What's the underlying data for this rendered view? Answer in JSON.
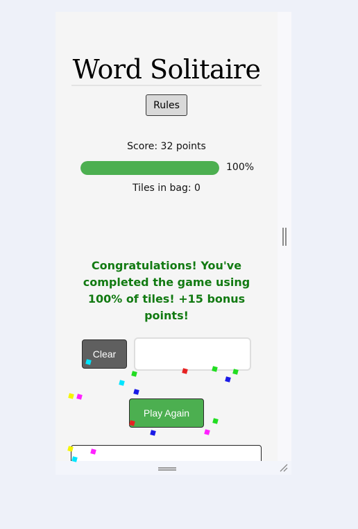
{
  "title": "Word Solitaire",
  "rules_button": "Rules",
  "score_text": "Score: 32 points",
  "progress": {
    "percent": 100,
    "label": "100%"
  },
  "tiles_text": "Tiles in bag: 0",
  "congrats_text": "Congratulations! You've completed the game using 100% of tiles! +15 bonus points!",
  "clear_button": "Clear",
  "word_input": {
    "value": "",
    "placeholder": ""
  },
  "play_again_button": "Play Again",
  "colors": {
    "accent_green": "#4caf50",
    "congrats_green": "#127a12",
    "clear_gray": "#5f5f5f"
  }
}
